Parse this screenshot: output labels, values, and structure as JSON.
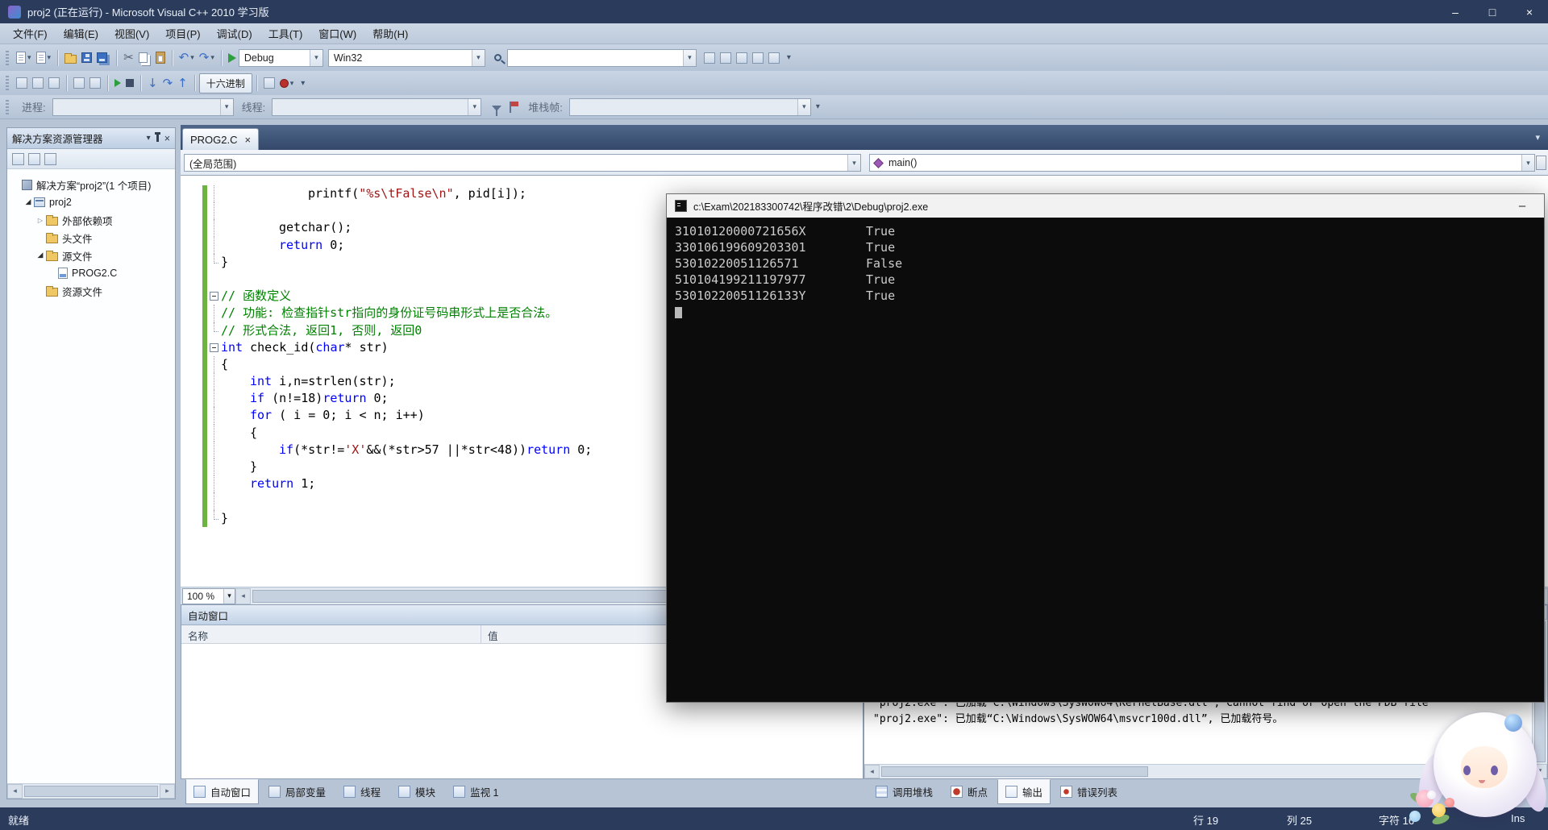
{
  "window": {
    "title": "proj2 (正在运行) - Microsoft Visual C++ 2010 学习版",
    "controls": {
      "minimize": "–",
      "maximize": "□",
      "close": "×"
    }
  },
  "glyphs": {
    "dropdown": "▾",
    "overflow": "▾",
    "collapsed": "▷",
    "expanded": "◢",
    "left": "◂",
    "right": "▸",
    "up": "▴",
    "down": "▾",
    "close": "×",
    "minimize": "–",
    "undo": "↶",
    "redo": "↷",
    "scissors": "✂",
    "step_into": "↓",
    "step_over": "↷",
    "step_out": "↑"
  },
  "menu": {
    "items": [
      "文件(F)",
      "编辑(E)",
      "视图(V)",
      "项目(P)",
      "调试(D)",
      "工具(T)",
      "窗口(W)",
      "帮助(H)"
    ]
  },
  "toolbar_main": {
    "config": "Debug",
    "platform": "Win32",
    "search_value": ""
  },
  "toolbar_debug": {
    "hex_label": "十六进制"
  },
  "debug_location": {
    "process": "进程:",
    "thread": "线程:",
    "frame": "堆栈帧:"
  },
  "solution_explorer": {
    "title": "解决方案资源管理器",
    "items": [
      {
        "label": "解决方案“proj2”(1 个项目)",
        "level": 0,
        "icon": "solution",
        "expander": ""
      },
      {
        "label": "proj2",
        "level": 1,
        "icon": "project",
        "expander": "expanded"
      },
      {
        "label": "外部依赖项",
        "level": 2,
        "icon": "folder",
        "expander": "collapsed"
      },
      {
        "label": "头文件",
        "level": 2,
        "icon": "folder",
        "expander": ""
      },
      {
        "label": "源文件",
        "level": 2,
        "icon": "folder",
        "expander": "expanded"
      },
      {
        "label": "PROG2.C",
        "level": 3,
        "icon": "cfile",
        "expander": ""
      },
      {
        "label": "资源文件",
        "level": 2,
        "icon": "folder",
        "expander": ""
      }
    ]
  },
  "editor": {
    "tab_label": "PROG2.C",
    "scope": "(全局范围)",
    "member": "main()",
    "zoom": "100 %",
    "lines": [
      {
        "indent": 12,
        "fold": "v",
        "g": 1,
        "segs": [
          {
            "c": "p",
            "t": "printf("
          },
          {
            "c": "s",
            "t": "\"%s\\tFalse\\n\""
          },
          {
            "c": "p",
            "t": ", pid[i]);"
          }
        ]
      },
      {
        "indent": 0,
        "fold": "v",
        "g": 1,
        "segs": []
      },
      {
        "indent": 8,
        "fold": "v",
        "g": 1,
        "segs": [
          {
            "c": "p",
            "t": "getchar();"
          }
        ]
      },
      {
        "indent": 8,
        "fold": "v",
        "g": 1,
        "segs": [
          {
            "c": "k",
            "t": "return"
          },
          {
            "c": "p",
            "t": " 0;"
          }
        ]
      },
      {
        "indent": 0,
        "fold": "c",
        "g": 1,
        "segs": [
          {
            "c": "p",
            "t": "}"
          }
        ]
      },
      {
        "indent": 0,
        "fold": "",
        "g": 1,
        "segs": []
      },
      {
        "indent": 0,
        "fold": "b",
        "g": 1,
        "segs": [
          {
            "c": "m",
            "t": "// 函数定义"
          }
        ]
      },
      {
        "indent": 0,
        "fold": "v",
        "g": 1,
        "segs": [
          {
            "c": "m",
            "t": "// 功能: 检查指针str指向的身份证号码串形式上是否合法。"
          }
        ]
      },
      {
        "indent": 0,
        "fold": "c",
        "g": 1,
        "segs": [
          {
            "c": "m",
            "t": "// 形式合法, 返回1, 否则, 返回0"
          }
        ]
      },
      {
        "indent": 0,
        "fold": "b",
        "g": 1,
        "segs": [
          {
            "c": "k",
            "t": "int"
          },
          {
            "c": "p",
            "t": " check_id("
          },
          {
            "c": "k",
            "t": "char"
          },
          {
            "c": "p",
            "t": "* str)"
          }
        ]
      },
      {
        "indent": 0,
        "fold": "v",
        "g": 1,
        "segs": [
          {
            "c": "p",
            "t": "{"
          }
        ]
      },
      {
        "indent": 4,
        "fold": "v",
        "g": 1,
        "segs": [
          {
            "c": "k",
            "t": "int"
          },
          {
            "c": "p",
            "t": " i,n=strlen(str);"
          }
        ]
      },
      {
        "indent": 4,
        "fold": "v",
        "g": 1,
        "segs": [
          {
            "c": "k",
            "t": "if"
          },
          {
            "c": "p",
            "t": " (n!=18)"
          },
          {
            "c": "k",
            "t": "return"
          },
          {
            "c": "p",
            "t": " 0;"
          }
        ]
      },
      {
        "indent": 4,
        "fold": "v",
        "g": 1,
        "segs": [
          {
            "c": "k",
            "t": "for"
          },
          {
            "c": "p",
            "t": " ( i = 0; i < n; i++)"
          }
        ]
      },
      {
        "indent": 4,
        "fold": "v",
        "g": 1,
        "segs": [
          {
            "c": "p",
            "t": "{"
          }
        ]
      },
      {
        "indent": 8,
        "fold": "v",
        "g": 1,
        "segs": [
          {
            "c": "k",
            "t": "if"
          },
          {
            "c": "p",
            "t": "(*str!="
          },
          {
            "c": "s",
            "t": "'X'"
          },
          {
            "c": "p",
            "t": "&&(*str>57 ||*str<48))"
          },
          {
            "c": "k",
            "t": "return"
          },
          {
            "c": "p",
            "t": " 0;"
          }
        ]
      },
      {
        "indent": 4,
        "fold": "v",
        "g": 1,
        "segs": [
          {
            "c": "p",
            "t": "}"
          }
        ]
      },
      {
        "indent": 4,
        "fold": "v",
        "g": 1,
        "segs": [
          {
            "c": "k",
            "t": "return"
          },
          {
            "c": "p",
            "t": " 1;"
          }
        ]
      },
      {
        "indent": 0,
        "fold": "v",
        "g": 1,
        "segs": []
      },
      {
        "indent": 0,
        "fold": "c",
        "g": 1,
        "segs": [
          {
            "c": "p",
            "t": "}"
          }
        ]
      }
    ]
  },
  "autos": {
    "title": "自动窗口",
    "columns": [
      "名称",
      "值"
    ]
  },
  "bottom_left_tabs": [
    {
      "label": "自动窗口",
      "icon": "autos",
      "active": true
    },
    {
      "label": "局部变量",
      "icon": "locals",
      "active": false
    },
    {
      "label": "线程",
      "icon": "threads",
      "active": false
    },
    {
      "label": "模块",
      "icon": "modules",
      "active": false
    },
    {
      "label": "监视 1",
      "icon": "watch",
      "active": false
    }
  ],
  "bottom_right_tabs": [
    {
      "label": "调用堆栈",
      "icon": "callstack",
      "active": false
    },
    {
      "label": "断点",
      "icon": "breakpoints",
      "active": false
    },
    {
      "label": "输出",
      "icon": "output",
      "active": true
    },
    {
      "label": "错误列表",
      "icon": "errorlist",
      "active": false
    }
  ],
  "console": {
    "title": "c:\\Exam\\202183300742\\程序改错\\2\\Debug\\proj2.exe",
    "rows": [
      {
        "id": "31010120000721656X",
        "result": "True"
      },
      {
        "id": "330106199609203301",
        "result": "True"
      },
      {
        "id": "53010220051126571",
        "result": "False"
      },
      {
        "id": "510104199211197977",
        "result": "True"
      },
      {
        "id": "53010220051126133Y",
        "result": "True"
      }
    ]
  },
  "output": {
    "lines": [
      "\"proj2.exe\": 已加载“C:\\Windows\\SysWOW64\\KernelBase.dll”, Cannot find or open the PDB file",
      "\"proj2.exe\": 已加载“C:\\Windows\\SysWOW64\\msvcr100d.dll”, 已加载符号。"
    ]
  },
  "status_bar": {
    "ready": "就绪",
    "line": "行 19",
    "column": "列 25",
    "char": "字符 16",
    "mode": "Ins"
  }
}
